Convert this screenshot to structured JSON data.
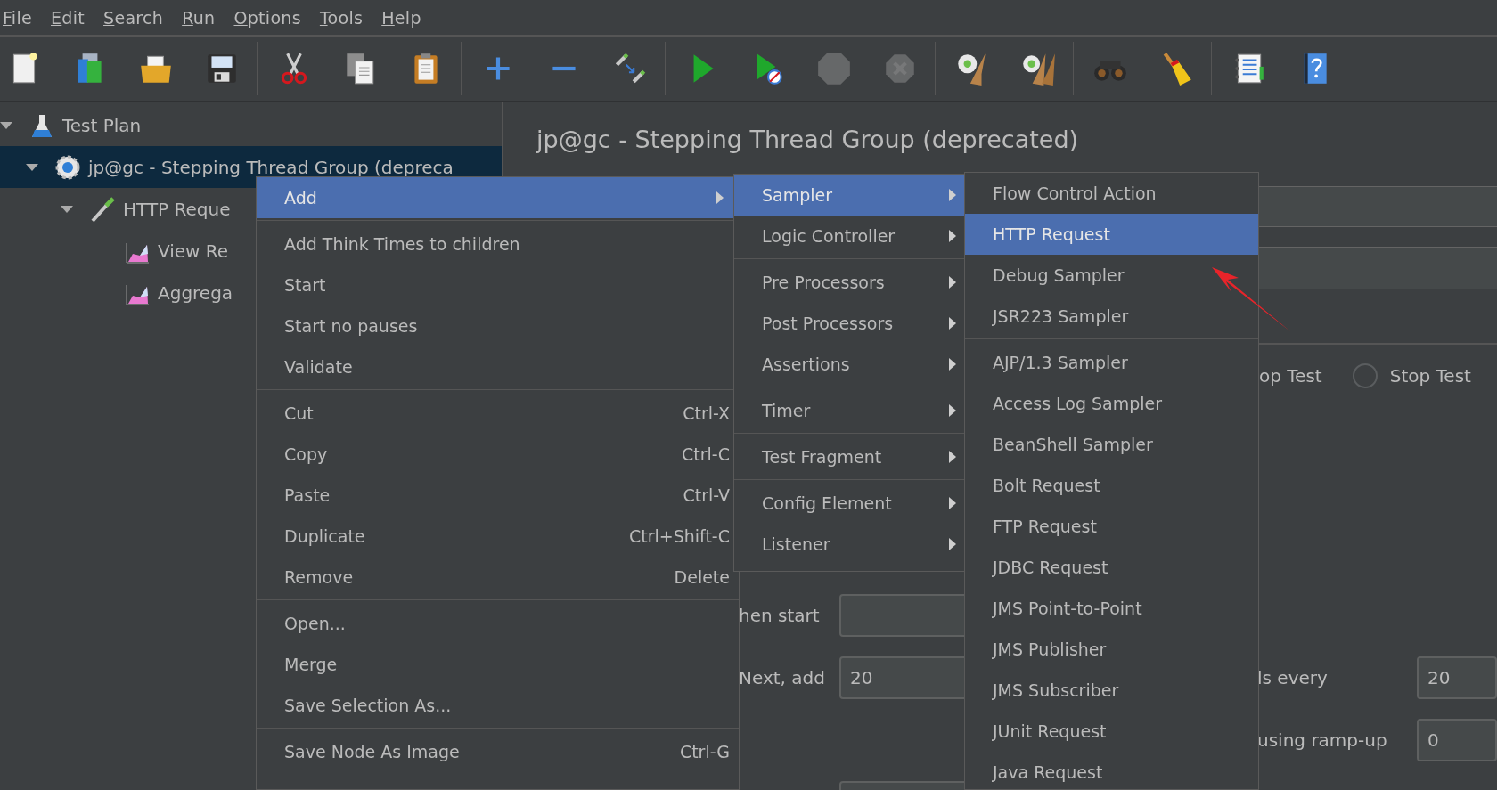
{
  "menu_bar": [
    {
      "label": "File"
    },
    {
      "label": "Edit"
    },
    {
      "label": "Search"
    },
    {
      "label": "Run"
    },
    {
      "label": "Options"
    },
    {
      "label": "Tools"
    },
    {
      "label": "Help"
    }
  ],
  "toolbar": [
    [
      {
        "disabled": false
      },
      {
        "disabled": false
      },
      {
        "disabled": false
      },
      {
        "disabled": false
      }
    ],
    [
      {
        "disabled": false
      },
      {
        "disabled": false
      },
      {
        "disabled": false
      }
    ],
    [
      {
        "disabled": false
      },
      {
        "disabled": false
      },
      {
        "disabled": false
      }
    ],
    [
      {
        "disabled": false
      },
      {
        "disabled": false
      },
      {
        "disabled": true
      },
      {
        "disabled": true
      }
    ],
    [
      {
        "disabled": false
      },
      {
        "disabled": false
      }
    ],
    [
      {
        "disabled": false
      },
      {
        "disabled": false
      }
    ],
    [
      {
        "disabled": false
      },
      {
        "disabled": false
      }
    ]
  ],
  "tree": [
    {
      "label": "Test Plan",
      "kind": "plan",
      "expanded": true,
      "selected": false,
      "children": [
        {
          "label": "jp@gc - Stepping Thread Group (depreca",
          "kind": "group",
          "expanded": true,
          "selected": true,
          "children": [
            {
              "label": "HTTP Reque",
              "kind": "sampler",
              "expanded": true,
              "selected": false,
              "children": [
                {
                  "label": "View Re",
                  "kind": "listener",
                  "selected": false
                },
                {
                  "label": "Aggrega",
                  "kind": "listener",
                  "selected": false
                }
              ]
            }
          ]
        }
      ]
    }
  ],
  "panel": {
    "title": "jp@gc - Stepping Thread Group (deprecated)",
    "stop_row": {
      "text": "op Test",
      "options": [
        {
          "label": "Stop Test",
          "selected": false
        }
      ]
    },
    "form_rows": [
      [
        {
          "label": "hen start"
        }
      ],
      [
        {
          "label": "Next, add",
          "value": "20"
        },
        {
          "label": "ls every",
          "value": "20"
        }
      ],
      [
        {},
        {
          "label": "using ramp-up",
          "value": "0"
        }
      ],
      [
        {
          "field": true
        }
      ]
    ]
  },
  "context_menu": {
    "items": [
      {
        "kind": "item",
        "label": "Add",
        "submenu": true,
        "selected": true
      },
      {
        "kind": "separator"
      },
      {
        "kind": "item",
        "label": "Add Think Times to children",
        "selected": false
      },
      {
        "kind": "item",
        "label": "Start",
        "selected": false
      },
      {
        "kind": "item",
        "label": "Start no pauses",
        "selected": false
      },
      {
        "kind": "item",
        "label": "Validate",
        "selected": false
      },
      {
        "kind": "separator"
      },
      {
        "kind": "item",
        "label": "Cut",
        "shortcut": "Ctrl-X",
        "selected": false
      },
      {
        "kind": "item",
        "label": "Copy",
        "shortcut": "Ctrl-C",
        "selected": false
      },
      {
        "kind": "item",
        "label": "Paste",
        "shortcut": "Ctrl-V",
        "selected": false
      },
      {
        "kind": "item",
        "label": "Duplicate",
        "shortcut": "Ctrl+Shift-C",
        "selected": false
      },
      {
        "kind": "item",
        "label": "Remove",
        "shortcut": "Delete",
        "selected": false
      },
      {
        "kind": "separator"
      },
      {
        "kind": "item",
        "label": "Open...",
        "selected": false
      },
      {
        "kind": "item",
        "label": "Merge",
        "selected": false
      },
      {
        "kind": "item",
        "label": "Save Selection As...",
        "selected": false
      },
      {
        "kind": "separator"
      },
      {
        "kind": "item",
        "label": "Save Node As Image",
        "shortcut": "Ctrl-G",
        "selected": false
      }
    ]
  },
  "add_menu": {
    "items": [
      {
        "kind": "item",
        "label": "Sampler",
        "submenu": true,
        "selected": true
      },
      {
        "kind": "item",
        "label": "Logic Controller",
        "submenu": true,
        "selected": false
      },
      {
        "kind": "separator"
      },
      {
        "kind": "item",
        "label": "Pre Processors",
        "submenu": true,
        "selected": false
      },
      {
        "kind": "item",
        "label": "Post Processors",
        "submenu": true,
        "selected": false
      },
      {
        "kind": "item",
        "label": "Assertions",
        "submenu": true,
        "selected": false
      },
      {
        "kind": "separator"
      },
      {
        "kind": "item",
        "label": "Timer",
        "submenu": true,
        "selected": false
      },
      {
        "kind": "separator"
      },
      {
        "kind": "item",
        "label": "Test Fragment",
        "submenu": true,
        "selected": false
      },
      {
        "kind": "separator"
      },
      {
        "kind": "item",
        "label": "Config Element",
        "submenu": true,
        "selected": false
      },
      {
        "kind": "item",
        "label": "Listener",
        "submenu": true,
        "selected": false
      }
    ]
  },
  "sampler_menu": {
    "items": [
      {
        "kind": "item",
        "label": "Flow Control Action",
        "selected": false
      },
      {
        "kind": "item",
        "label": "HTTP Request",
        "selected": true
      },
      {
        "kind": "item",
        "label": "Debug Sampler",
        "selected": false
      },
      {
        "kind": "item",
        "label": "JSR223 Sampler",
        "selected": false
      },
      {
        "kind": "separator"
      },
      {
        "kind": "item",
        "label": "AJP/1.3 Sampler",
        "selected": false
      },
      {
        "kind": "item",
        "label": "Access Log Sampler",
        "selected": false
      },
      {
        "kind": "item",
        "label": "BeanShell Sampler",
        "selected": false
      },
      {
        "kind": "item",
        "label": "Bolt Request",
        "selected": false
      },
      {
        "kind": "item",
        "label": "FTP Request",
        "selected": false
      },
      {
        "kind": "item",
        "label": "JDBC Request",
        "selected": false
      },
      {
        "kind": "item",
        "label": "JMS Point-to-Point",
        "selected": false
      },
      {
        "kind": "item",
        "label": "JMS Publisher",
        "selected": false
      },
      {
        "kind": "item",
        "label": "JMS Subscriber",
        "selected": false
      },
      {
        "kind": "item",
        "label": "JUnit Request",
        "selected": false
      },
      {
        "kind": "item",
        "label": "Java Request",
        "selected": false
      }
    ]
  }
}
